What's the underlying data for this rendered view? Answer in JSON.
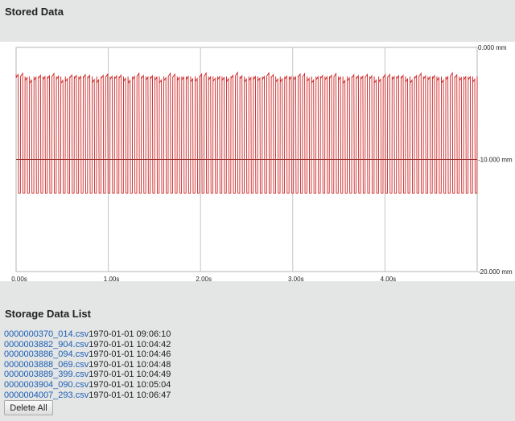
{
  "page": {
    "stored_title": "Stored Data",
    "list_title": "Storage Data List"
  },
  "chart_data": {
    "type": "line",
    "title": "",
    "xlabel": "",
    "ylabel": "",
    "x_unit": "s",
    "y_unit": "mm",
    "xlim": [
      0,
      5.0
    ],
    "ylim": [
      -20,
      0
    ],
    "x_ticks": [
      "0.00s",
      "1.00s",
      "2.00s",
      "3.00s",
      "4.00s"
    ],
    "y_ticks": [
      "0.000 mm",
      "-10.000 mm",
      "-20.000 mm"
    ],
    "grid": true,
    "legend": "none",
    "series": [
      {
        "color": "#cc2222",
        "waveform": "square",
        "high": -2.6,
        "low": -13.0,
        "cycles": 103,
        "duty": 0.5,
        "x_start": 0.0,
        "x_end": 5.0
      }
    ],
    "reference_line": {
      "value": -10.0,
      "color": "#8b3a3a"
    }
  },
  "files": [
    {
      "name": "0000000370_014.csv",
      "date": "1970-01-01 09:06:10"
    },
    {
      "name": "0000003882_904.csv",
      "date": "1970-01-01 10:04:42"
    },
    {
      "name": "0000003886_094.csv",
      "date": "1970-01-01 10:04:46"
    },
    {
      "name": "0000003888_069.csv",
      "date": "1970-01-01 10:04:48"
    },
    {
      "name": "0000003889_399.csv",
      "date": "1970-01-01 10:04:49"
    },
    {
      "name": "0000003904_090.csv",
      "date": "1970-01-01 10:05:04"
    },
    {
      "name": "0000004007_293.csv",
      "date": "1970-01-01 10:06:47"
    }
  ],
  "buttons": {
    "delete_all": "Delete All"
  }
}
